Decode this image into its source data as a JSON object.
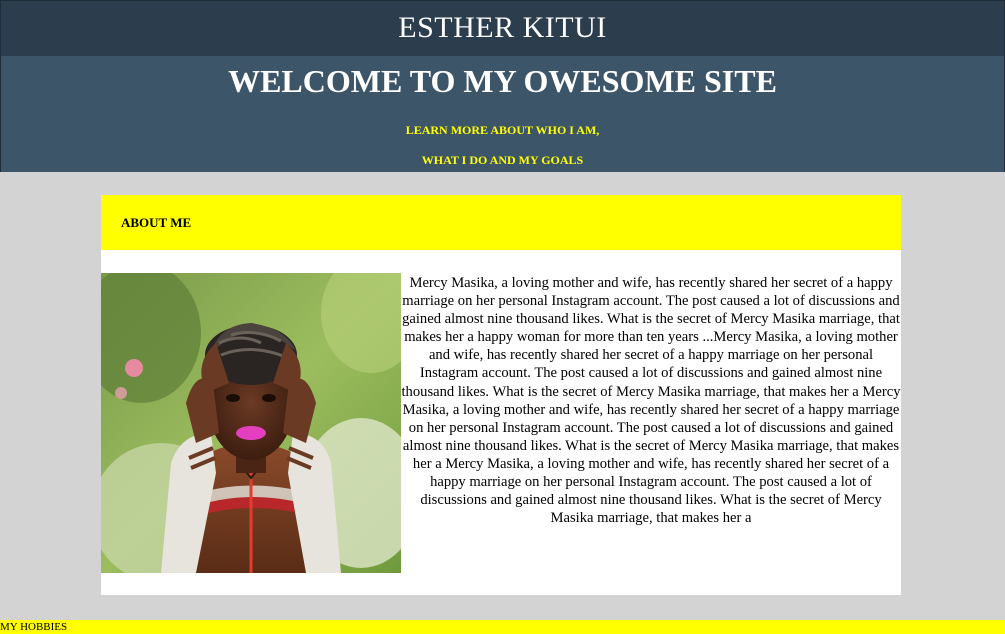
{
  "site": {
    "name": "ESTHER KITUI"
  },
  "hero": {
    "title": "WELCOME TO MY OWESOME SITE",
    "subtitle_line1": "LEARN MORE ABOUT WHO I AM,",
    "subtitle_line2": "WHAT I DO AND MY GOALS"
  },
  "about": {
    "heading": "ABOUT ME",
    "photo_alt": "Portrait of a smiling woman with braided hair wearing a brown leather jacket",
    "body": "Mercy Masika, a loving mother and wife, has recently shared her secret of a happy marriage on her personal Instagram account. The post caused a lot of discussions and gained almost nine thousand likes. What is the secret of Mercy Masika marriage, that makes her a happy woman for more than ten years ...Mercy Masika, a loving mother and wife, has recently shared her secret of a happy marriage on her personal Instagram account. The post caused a lot of discussions and gained almost nine thousand likes. What is the secret of Mercy Masika marriage, that makes her a Mercy Masika, a loving mother and wife, has recently shared her secret of a happy marriage on her personal Instagram account. The post caused a lot of discussions and gained almost nine thousand likes. What is the secret of Mercy Masika marriage, that makes her a Mercy Masika, a loving mother and wife, has recently shared her secret of a happy marriage on her personal Instagram account. The post caused a lot of discussions and gained almost nine thousand likes. What is the secret of Mercy Masika marriage, that makes her a"
  },
  "hobbies": {
    "heading": "MY HOBBIES"
  },
  "colors": {
    "top_band": "#2c3e4e",
    "hero": "#3d5569",
    "accent_yellow": "#ffff00",
    "page_bg": "#d3d3d3"
  }
}
